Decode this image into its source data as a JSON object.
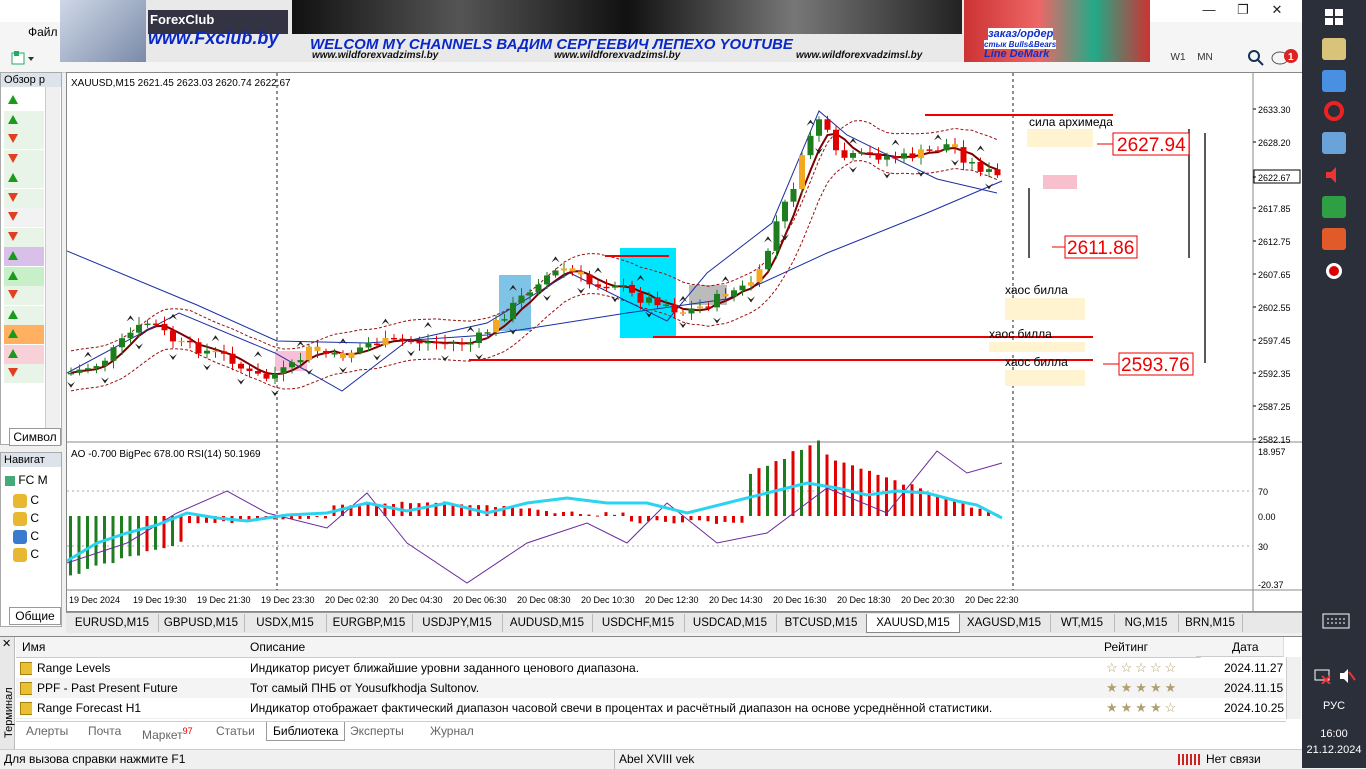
{
  "window": {
    "menu_file": "Файл",
    "minimize": "—",
    "restore": "❐",
    "close": "✕"
  },
  "banner": {
    "brand": "ForexClub",
    "site": "www.Fxclub.by",
    "headline": "WELCOM MY CHANNELS ВАДИМ СЕРГЕЕВИЧ ЛЕПЕХО YOUTUBE",
    "link1": "www.wildforexvadzimsl.by",
    "link2": "www.wildforexvadzimsl.by",
    "link3": "www.wildforexvadzimsl.by",
    "order": "заказ/ордер",
    "bulls_bears": "стык Bulls&Bears",
    "line_demark": "Line DeMark"
  },
  "toolbar": {
    "timeframes": [
      "W1",
      "MN"
    ],
    "notifications": "1"
  },
  "overview": {
    "title": "Обзор р",
    "symbol_tab": "Символ"
  },
  "navigator": {
    "title": "Навигат",
    "root": "FC M",
    "items": [
      "C",
      "C",
      "C",
      "C"
    ],
    "general_tab": "Общие"
  },
  "chart": {
    "header": "XAUUSD,M15  2621.45 2623.03 2620.74 2622.67",
    "osc_header": "AO -0.700  BigPec 678.00  RSI(14) 50.1969",
    "price_labels": [
      "2633.30",
      "2628.20",
      "2622.67",
      "2617.85",
      "2612.75",
      "2607.65",
      "2602.55",
      "2597.45",
      "2592.35",
      "2587.25",
      "2582.15"
    ],
    "osc_labels": [
      "18.957",
      "70",
      "0.00",
      "30",
      "-20.37"
    ],
    "time_labels": [
      "19 Dec 2024",
      "19 Dec 19:30",
      "19 Dec 21:30",
      "19 Dec 23:30",
      "20 Dec 02:30",
      "20 Dec 04:30",
      "20 Dec 06:30",
      "20 Dec 08:30",
      "20 Dec 10:30",
      "20 Dec 12:30",
      "20 Dec 14:30",
      "20 Dec 16:30",
      "20 Dec 18:30",
      "20 Dec 20:30",
      "20 Dec 22:30"
    ],
    "annotations": {
      "archimedes": "сила архимеда",
      "chaos1": "хаос билла",
      "chaos2": "хаос билла",
      "chaos3": "хаос билла",
      "level_high": "2627.94",
      "level_mid": "2611.86",
      "level_low": "2593.76"
    },
    "colors": {
      "bull": "#1e7d1e",
      "bear": "#e00000",
      "ma_blue": "#1a2fa8",
      "ma_dark": "#7a0000",
      "rsi": "#2ad4f0",
      "cyan_box": "#00e5ff"
    }
  },
  "symbol_tabs": [
    "EURUSD,M15",
    "GBPUSD,M15",
    "USDX,M15",
    "EURGBP,M15",
    "USDJPY,M15",
    "AUDUSD,M15",
    "USDCHF,M15",
    "USDCAD,M15",
    "BTCUSD,M15",
    "XAUUSD,M15",
    "XAGUSD,M15",
    "WT,M15",
    "NG,M15",
    "BRN,M15"
  ],
  "active_symbol": "XAUUSD,M15",
  "terminal": {
    "side_label": "Терминал",
    "columns": {
      "name": "Имя",
      "description": "Описание",
      "rating": "Рейтинг",
      "date": "Дата"
    },
    "rows": [
      {
        "name": "Range Levels",
        "description": "Индикатор рисует ближайшие уровни заданного ценового диапазона.",
        "rating": "☆☆☆☆☆",
        "date": "2024.11.27"
      },
      {
        "name": "PPF - Past Present Future",
        "description": "Тот самый ПНБ от Yousufkhodja Sultonov.",
        "rating": "★★★★★",
        "date": "2024.11.15"
      },
      {
        "name": "Range Forecast H1",
        "description": "Индикатор отображает фактический диапазон часовой свечи в процентах и расчётный диапазон на основе усреднённой статистики.",
        "rating": "★★★★☆",
        "date": "2024.10.25"
      }
    ],
    "tabs": [
      "Алерты",
      "Почта",
      "Маркет",
      "Статьи",
      "Библиотека",
      "Эксперты",
      "Журнал"
    ],
    "market_badge": "97",
    "active_tab": "Библиотека"
  },
  "status": {
    "help": "Для вызова справки нажмите F1",
    "profile": "Abel XVIII vek",
    "connection": "Нет связи"
  },
  "taskbar": {
    "language": "РУС",
    "time": "16:00",
    "date": "21.12.2024"
  }
}
